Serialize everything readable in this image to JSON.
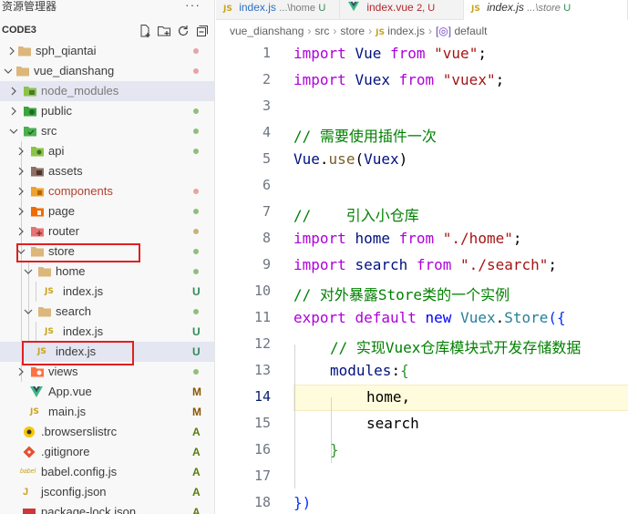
{
  "sidebar": {
    "title": "资源管理器",
    "more_label": "···",
    "project": "CODE3",
    "items": [
      {
        "label": "sph_qiantai",
        "status": "dot",
        "status_color": "#e8a3a3"
      },
      {
        "label": "vue_dianshang",
        "status": "dot",
        "status_color": "#e8a3a3"
      },
      {
        "label": "node_modules",
        "status": "",
        "status_color": ""
      },
      {
        "label": "public",
        "status": "dot",
        "status_color": "#8ec07c"
      },
      {
        "label": "src",
        "status": "dot",
        "status_color": "#8ec07c"
      },
      {
        "label": "api",
        "status": "dot",
        "status_color": "#8ec07c"
      },
      {
        "label": "assets",
        "status": "",
        "status_color": ""
      },
      {
        "label": "components",
        "status": "dot",
        "status_color": "#e8a3a3"
      },
      {
        "label": "page",
        "status": "dot",
        "status_color": "#8ec07c"
      },
      {
        "label": "router",
        "status": "dot",
        "status_color": "#c9b37a"
      },
      {
        "label": "store",
        "status": "dot",
        "status_color": "#8ec07c"
      },
      {
        "label": "home",
        "status": "dot",
        "status_color": "#8ec07c"
      },
      {
        "label": "index.js",
        "status": "U",
        "status_color": "#2e8b57"
      },
      {
        "label": "search",
        "status": "dot",
        "status_color": "#8ec07c"
      },
      {
        "label": "index.js",
        "status": "U",
        "status_color": "#2e8b57"
      },
      {
        "label": "index.js",
        "status": "U",
        "status_color": "#2e8b57"
      },
      {
        "label": "views",
        "status": "dot",
        "status_color": "#8ec07c"
      },
      {
        "label": "App.vue",
        "status": "M",
        "status_color": "#895503"
      },
      {
        "label": "main.js",
        "status": "M",
        "status_color": "#895503"
      },
      {
        "label": ".browserslistrc",
        "status": "A",
        "status_color": "#587c0c"
      },
      {
        "label": ".gitignore",
        "status": "A",
        "status_color": "#587c0c"
      },
      {
        "label": "babel.config.js",
        "status": "A",
        "status_color": "#587c0c"
      },
      {
        "label": "jsconfig.json",
        "status": "A",
        "status_color": "#587c0c"
      },
      {
        "label": "package-lock.json",
        "status": "A",
        "status_color": "#587c0c"
      }
    ]
  },
  "tabs": [
    {
      "icon": "JS",
      "name": "index.js",
      "sub": "...\\home",
      "status": "U",
      "status_color": "#2e8b57"
    },
    {
      "icon": "V",
      "name": "index.vue",
      "sub": "",
      "status": "2, U",
      "status_color": "#b0282e"
    },
    {
      "icon": "JS",
      "name": "index.js",
      "sub": "...\\store",
      "status": "U",
      "status_color": "#2e8b57"
    }
  ],
  "breadcrumb": {
    "parts": [
      "vue_dianshang",
      "src",
      "store",
      "index.js",
      "default"
    ],
    "js_icon": "JS"
  },
  "editor": {
    "current_line": 14,
    "line_numbers": [
      "1",
      "2",
      "3",
      "4",
      "5",
      "6",
      "7",
      "8",
      "9",
      "10",
      "11",
      "12",
      "13",
      "14",
      "15",
      "16",
      "17",
      "18"
    ],
    "lines": [
      {
        "import_kw": "import",
        "name": "Vue",
        "from_kw": "from",
        "src": "\"vue\"",
        "semi": ";"
      },
      {
        "import_kw": "import",
        "name": "Vuex",
        "from_kw": "from",
        "src": "\"vuex\"",
        "semi": ";"
      },
      {
        "text": ""
      },
      {
        "comment": "// 需要使用插件一次"
      },
      {
        "obj": "Vue",
        "dot": ".",
        "fn": "use",
        "open": "(",
        "arg": "Vuex",
        "close": ")"
      },
      {
        "text": ""
      },
      {
        "comment": "//    引入小仓库"
      },
      {
        "import_kw": "import",
        "name": "home",
        "from_kw": "from",
        "src": "\"./home\"",
        "semi": ";"
      },
      {
        "import_kw": "import",
        "name": "search",
        "from_kw": "from",
        "src": "\"./search\"",
        "semi": ";"
      },
      {
        "comment": "// 对外暴露Store类的一个实例"
      },
      {
        "export_kw": "export",
        "default_kw": "default",
        "new_kw": "new",
        "cls": "Vuex",
        "dot": ".",
        "cls2": "Store",
        "open": "({"
      },
      {
        "comment": "// 实现Vuex仓库模块式开发存储数据"
      },
      {
        "prop": "modules",
        "colon": ":",
        "brace": "{"
      },
      {
        "text": "home,"
      },
      {
        "text": "search"
      },
      {
        "text": "}"
      },
      {
        "text": ""
      },
      {
        "text": "})"
      }
    ]
  }
}
